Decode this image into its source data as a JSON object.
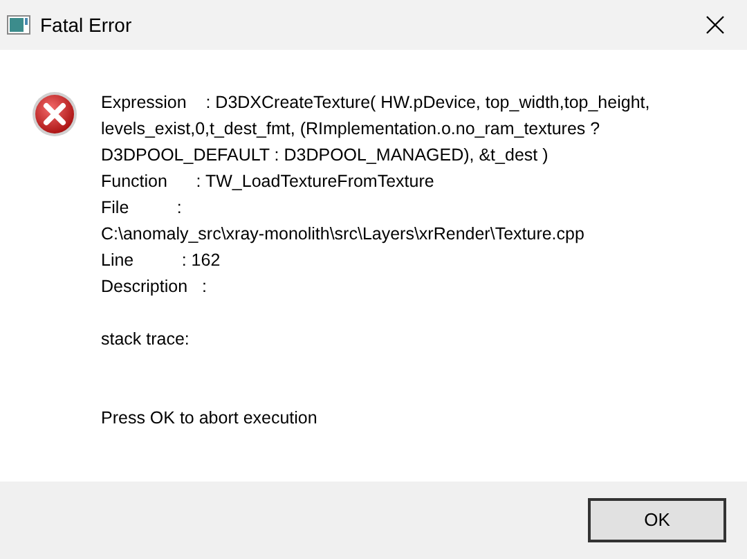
{
  "window": {
    "title": "Fatal Error"
  },
  "message": {
    "paragraphs": [
      {
        "lines": [
          "Expression    : D3DXCreateTexture( HW.pDevice, top_width,top_height,",
          "levels_exist,0,t_dest_fmt, (RImplementation.o.no_ram_textures ?",
          "D3DPOOL_DEFAULT : D3DPOOL_MANAGED), &t_dest )",
          "Function      : TW_LoadTextureFromTexture",
          "File          :",
          "C:\\anomaly_src\\xray-monolith\\src\\Layers\\xrRender\\Texture.cpp",
          "Line          : 162",
          "Description   :"
        ]
      },
      {
        "lines": [
          "stack trace:"
        ]
      },
      {
        "lines": [
          "Press OK to abort execution"
        ]
      }
    ]
  },
  "buttons": [
    "OK"
  ]
}
